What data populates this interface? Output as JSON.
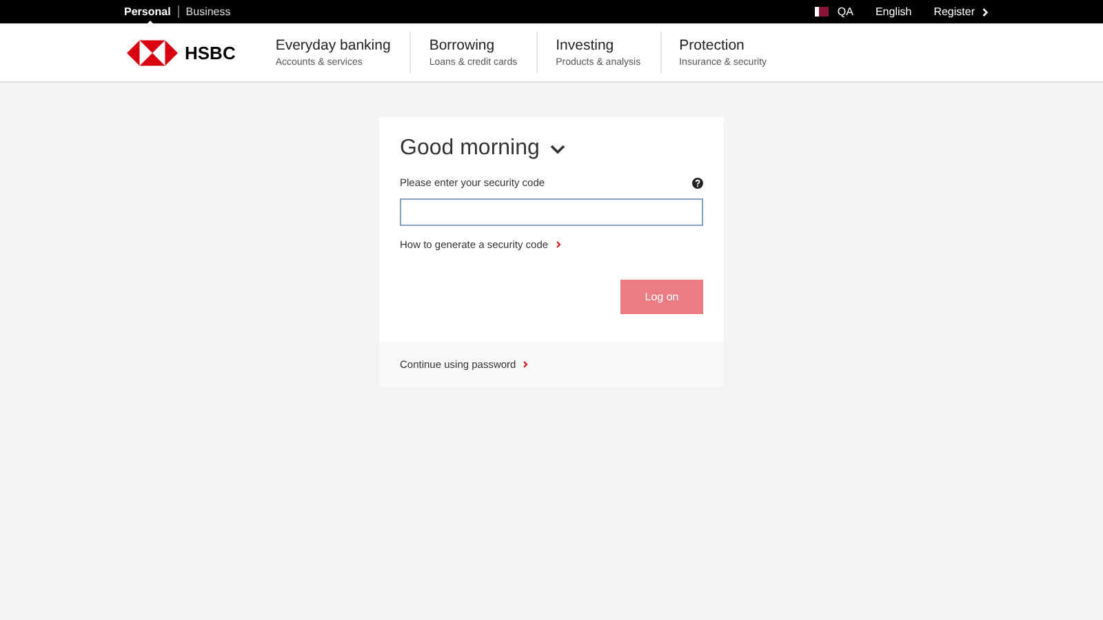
{
  "top_bar": {
    "segments": [
      {
        "label": "Personal",
        "selected": true
      },
      {
        "label": "Business",
        "selected": false
      }
    ],
    "region": "QA",
    "language": "English",
    "register": "Register"
  },
  "brand": {
    "name": "HSBC"
  },
  "nav": [
    {
      "title": "Everyday banking",
      "subtitle": "Accounts & services"
    },
    {
      "title": "Borrowing",
      "subtitle": "Loans & credit cards"
    },
    {
      "title": "Investing",
      "subtitle": "Products & analysis"
    },
    {
      "title": "Protection",
      "subtitle": "Insurance & security"
    }
  ],
  "login": {
    "greeting": "Good morning",
    "field_label": "Please enter your security code",
    "help_link": "How to generate a security code",
    "button": {
      "label": "Log on",
      "disabled": true
    },
    "alt_link": "Continue using password"
  }
}
